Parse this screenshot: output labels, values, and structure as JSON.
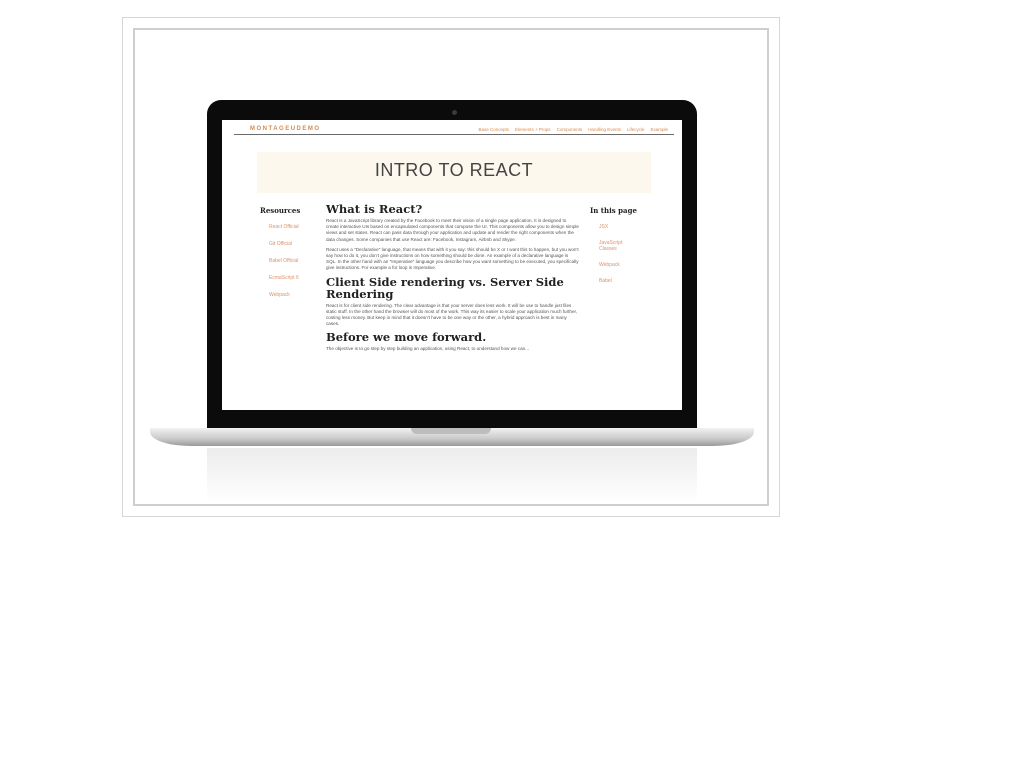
{
  "site": {
    "brand": "MONTAGEUDEMO",
    "nav": [
      "Base Concepts",
      "Elements + Props",
      "Components",
      "Handling Events",
      "Lifecycle",
      "Example"
    ]
  },
  "hero": {
    "title": "INTRO TO REACT"
  },
  "sidebar_left": {
    "heading": "Resources",
    "links": [
      "React Official",
      "Git Official",
      "Babel Official",
      "EcmaScript 6",
      "Webpack"
    ]
  },
  "sidebar_right": {
    "heading": "In this page",
    "links": [
      "JSX",
      "JavaScript Classes",
      "Webpack",
      "Babel"
    ]
  },
  "content": {
    "h1": "What is React?",
    "p1": "React is a JavaScript library created by the Facebook to meet their vision of a single page application. It is designed to create interactive UIs based on encapsulated components that compose the UI. This components allow you to design simple views and set states. React can pass data through your application and update and render the right components when the data changes. Some companies that use React are: Facebook, Instagram, Airbnb and Skype.",
    "p2": "React uses a \"Declarative\" language, that means that with it you say: this should be X or I want this to happen, but you won't say how to do it, you don't give instructions on how something should be done. An example of a declarative language is SQL. In the other hand with an \"Imperative\" language you describe how you want something to be executed, you specifically give instructions. For example a for loop is Imperative.",
    "h2": "Client Side rendering vs. Server Side Rendering",
    "p3": "React is for client side rendering. The clear advantage is that your server does less work. It will be use to handle just files static stuff. In the other hand the browser will do most of the work. This way its easier to scale your application much further, costing less money. But keep in mind that it doesn't have to be one way or the other, a hybrid approach is best in many cases.",
    "h3": "Before we move forward.",
    "p4": "The objective is to go step by step building an application, using React, to understand how we can..."
  }
}
